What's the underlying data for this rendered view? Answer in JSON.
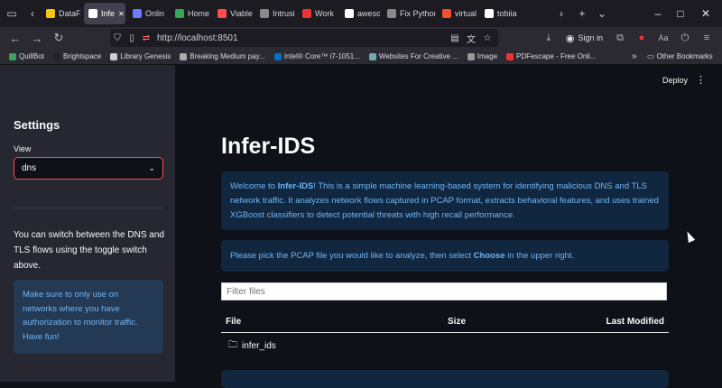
{
  "tabs": [
    {
      "label": "DataF",
      "color": "#f5c518"
    },
    {
      "label": "Infe",
      "color": "#ffffff",
      "active": true
    },
    {
      "label": "Onlin",
      "color": "#6a7bff"
    },
    {
      "label": "Home",
      "color": "#34a853"
    },
    {
      "label": "Viable",
      "color": "#ff4b4b"
    },
    {
      "label": "Intrusi",
      "color": "#888888"
    },
    {
      "label": "Work",
      "color": "#e33"
    },
    {
      "label": "aweso",
      "color": "#ffffff"
    },
    {
      "label": "Fix Python",
      "color": "#888888"
    },
    {
      "label": "virtual",
      "color": "#f05032"
    },
    {
      "label": "tobiia",
      "color": "#ffffff"
    }
  ],
  "browser": {
    "url": "http://localhost:8501",
    "sign_in": "Sign in"
  },
  "bookmarks": [
    {
      "label": "QuillBot",
      "color": "#3ea35a"
    },
    {
      "label": "Brightspace",
      "color": "#222222"
    },
    {
      "label": "Library Genesis",
      "color": "#cccccc"
    },
    {
      "label": "Breaking Medium pay...",
      "color": "#aaaaaa"
    },
    {
      "label": "Intel® Core™ i7-1051...",
      "color": "#0071c5"
    },
    {
      "label": "Websites For Creative ...",
      "color": "#7aa"
    },
    {
      "label": "Image",
      "color": "#999999"
    },
    {
      "label": "PDFescape - Free Onli...",
      "color": "#e33"
    }
  ],
  "other_bookmarks": "Other Bookmarks",
  "sidebar": {
    "title": "Settings",
    "view_label": "View",
    "view_value": "dns",
    "help_text": "You can switch between the DNS and TLS flows using the toggle switch above.",
    "notice": "Make sure to only use on networks where you have authorization to monitor traffic. Have fun!"
  },
  "main": {
    "deploy": "Deploy",
    "title": "Infer-IDS",
    "welcome_prefix": "Welcome to ",
    "welcome_bold": "Infer-IDS",
    "welcome_rest": "! This is a simple machine learning-based system for identifying malicious DNS and TLS network traffic. It analyzes network flows captured in PCAP format, extracts behavioral features, and uses trained XGBoost classifiers to detect potential threats with high recall performance.",
    "pick_prefix": "Please pick the PCAP file you would like to analyze, then select ",
    "pick_bold": "Choose",
    "pick_rest": " in the upper right.",
    "filter_placeholder": "Filter files",
    "columns": {
      "file": "File",
      "size": "Size",
      "modified": "Last Modified"
    },
    "rows": [
      {
        "name": "infer_ids"
      }
    ]
  }
}
